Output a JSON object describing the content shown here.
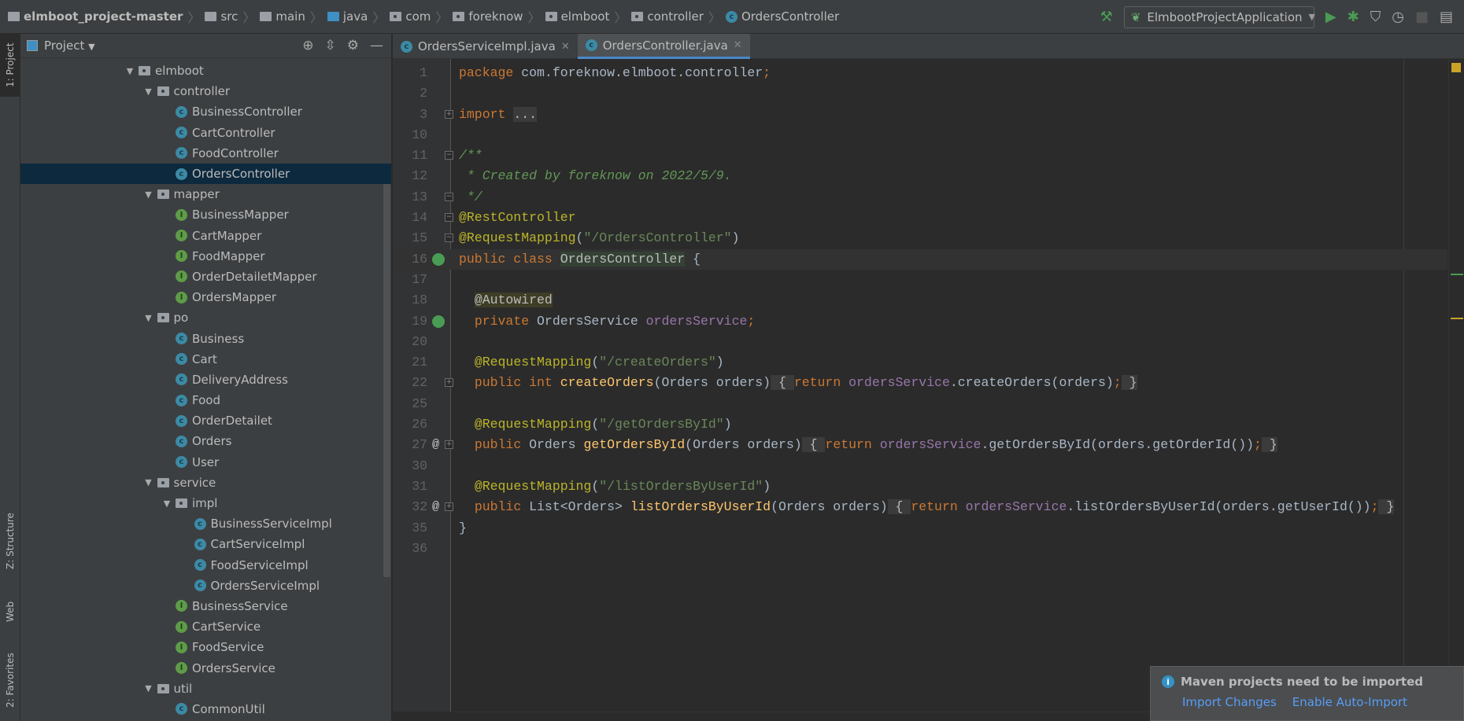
{
  "breadcrumb": [
    {
      "label": "elmboot_project-master",
      "icon": "project-folder-icon"
    },
    {
      "label": "src",
      "icon": "folder-icon"
    },
    {
      "label": "main",
      "icon": "folder-icon"
    },
    {
      "label": "java",
      "icon": "source-folder-icon"
    },
    {
      "label": "com",
      "icon": "package-icon"
    },
    {
      "label": "foreknow",
      "icon": "package-icon"
    },
    {
      "label": "elmboot",
      "icon": "package-icon"
    },
    {
      "label": "controller",
      "icon": "package-icon"
    },
    {
      "label": "OrdersController",
      "icon": "class-icon"
    }
  ],
  "toolbar": {
    "run_config": "ElmbootProjectApplication",
    "icons": [
      "build-hammer-icon",
      "run-icon",
      "debug-icon",
      "coverage-icon",
      "profile-icon",
      "stop-icon",
      "project-structure-icon"
    ]
  },
  "left_strip": {
    "project": "1: Project",
    "structure": "Z: Structure",
    "web": "Web",
    "favorites": "2: Favorites"
  },
  "panel": {
    "title": "Project"
  },
  "tree": [
    {
      "label": "elmboot",
      "level": 0,
      "type": "folder"
    },
    {
      "label": "controller",
      "level": 1,
      "type": "folder"
    },
    {
      "label": "BusinessController",
      "level": 2,
      "type": "class"
    },
    {
      "label": "CartController",
      "level": 2,
      "type": "class"
    },
    {
      "label": "FoodController",
      "level": 2,
      "type": "class"
    },
    {
      "label": "OrdersController",
      "level": 2,
      "type": "class",
      "selected": true
    },
    {
      "label": "mapper",
      "level": 1,
      "type": "folder"
    },
    {
      "label": "BusinessMapper",
      "level": 2,
      "type": "interface"
    },
    {
      "label": "CartMapper",
      "level": 2,
      "type": "interface"
    },
    {
      "label": "FoodMapper",
      "level": 2,
      "type": "interface"
    },
    {
      "label": "OrderDetailetMapper",
      "level": 2,
      "type": "interface"
    },
    {
      "label": "OrdersMapper",
      "level": 2,
      "type": "interface"
    },
    {
      "label": "po",
      "level": 1,
      "type": "folder"
    },
    {
      "label": "Business",
      "level": 2,
      "type": "class"
    },
    {
      "label": "Cart",
      "level": 2,
      "type": "class"
    },
    {
      "label": "DeliveryAddress",
      "level": 2,
      "type": "class"
    },
    {
      "label": "Food",
      "level": 2,
      "type": "class"
    },
    {
      "label": "OrderDetailet",
      "level": 2,
      "type": "class"
    },
    {
      "label": "Orders",
      "level": 2,
      "type": "class"
    },
    {
      "label": "User",
      "level": 2,
      "type": "class"
    },
    {
      "label": "service",
      "level": 1,
      "type": "folder"
    },
    {
      "label": "impl",
      "level": 2,
      "type": "folder"
    },
    {
      "label": "BusinessServiceImpl",
      "level": 3,
      "type": "class"
    },
    {
      "label": "CartServiceImpl",
      "level": 3,
      "type": "class"
    },
    {
      "label": "FoodServiceImpl",
      "level": 3,
      "type": "class"
    },
    {
      "label": "OrdersServiceImpl",
      "level": 3,
      "type": "class"
    },
    {
      "label": "BusinessService",
      "level": 2,
      "type": "interface"
    },
    {
      "label": "CartService",
      "level": 2,
      "type": "interface"
    },
    {
      "label": "FoodService",
      "level": 2,
      "type": "interface"
    },
    {
      "label": "OrdersService",
      "level": 2,
      "type": "interface"
    },
    {
      "label": "util",
      "level": 1,
      "type": "folder"
    },
    {
      "label": "CommonUtil",
      "level": 2,
      "type": "class"
    }
  ],
  "tabs": [
    {
      "label": "OrdersServiceImpl.java",
      "active": false
    },
    {
      "label": "OrdersController.java",
      "active": true
    }
  ],
  "code": [
    {
      "n": "1",
      "t": [
        [
          "package",
          "kw"
        ],
        [
          " com.foreknow.elmboot.controller",
          "pl"
        ],
        [
          ";",
          "kw"
        ]
      ]
    },
    {
      "n": "2",
      "t": []
    },
    {
      "n": "3",
      "fold": "+",
      "t": [
        [
          "import",
          "kw"
        ],
        [
          " ",
          "pl"
        ],
        [
          "...",
          "fb"
        ]
      ]
    },
    {
      "n": "10",
      "t": []
    },
    {
      "n": "11",
      "fold": "-",
      "t": [
        [
          "/**",
          "cm"
        ]
      ]
    },
    {
      "n": "12",
      "t": [
        [
          " * Created by foreknow on 2022/5/9.",
          "cm"
        ]
      ]
    },
    {
      "n": "13",
      "fold": "-",
      "t": [
        [
          " */",
          "cm"
        ]
      ]
    },
    {
      "n": "14",
      "fold": "-",
      "t": [
        [
          "@RestController",
          "an"
        ]
      ]
    },
    {
      "n": "15",
      "fold": "-",
      "t": [
        [
          "@RequestMapping",
          "an"
        ],
        [
          "(",
          "pl"
        ],
        [
          "\"/OrdersController\"",
          "st"
        ],
        [
          ")",
          "pl"
        ]
      ]
    },
    {
      "n": "16",
      "mark": "bean-class-icon",
      "cur": true,
      "t": [
        [
          "public class ",
          "kw"
        ],
        [
          "OrdersController",
          "hl"
        ],
        [
          " {",
          "pl"
        ]
      ]
    },
    {
      "n": "17",
      "t": []
    },
    {
      "n": "18",
      "t": [
        [
          "  ",
          "pl"
        ],
        [
          "@Autowired",
          "ab"
        ]
      ]
    },
    {
      "n": "19",
      "mark": "autowired-bean-icon",
      "t": [
        [
          "  ",
          "pl"
        ],
        [
          "private ",
          "kw"
        ],
        [
          "OrdersService ",
          "pl"
        ],
        [
          "ordersService",
          "fd"
        ],
        [
          ";",
          "kw"
        ]
      ]
    },
    {
      "n": "20",
      "t": []
    },
    {
      "n": "21",
      "t": [
        [
          "  ",
          "pl"
        ],
        [
          "@RequestMapping",
          "an"
        ],
        [
          "(",
          "pl"
        ],
        [
          "\"/createOrders\"",
          "st"
        ],
        [
          ")",
          "pl"
        ]
      ]
    },
    {
      "n": "22",
      "fold": "+",
      "t": [
        [
          "  ",
          "pl"
        ],
        [
          "public int ",
          "kw"
        ],
        [
          "createOrders",
          "md"
        ],
        [
          "(Orders orders)",
          "pl"
        ],
        [
          " { ",
          "fb"
        ],
        [
          "return ",
          "kw"
        ],
        [
          "ordersService",
          "fd"
        ],
        [
          ".createOrders(orders)",
          "pl"
        ],
        [
          ";",
          "kw"
        ],
        [
          " }",
          "fb"
        ]
      ]
    },
    {
      "n": "25",
      "t": []
    },
    {
      "n": "26",
      "t": [
        [
          "  ",
          "pl"
        ],
        [
          "@RequestMapping",
          "an"
        ],
        [
          "(",
          "pl"
        ],
        [
          "\"/getOrdersById\"",
          "st"
        ],
        [
          ")",
          "pl"
        ]
      ]
    },
    {
      "n": "27",
      "mark": "at-icon",
      "fold": "+",
      "t": [
        [
          "  ",
          "pl"
        ],
        [
          "public ",
          "kw"
        ],
        [
          "Orders ",
          "pl"
        ],
        [
          "getOrdersById",
          "md"
        ],
        [
          "(Orders orders)",
          "pl"
        ],
        [
          " { ",
          "fb"
        ],
        [
          "return ",
          "kw"
        ],
        [
          "ordersService",
          "fd"
        ],
        [
          ".getOrdersById(orders.getOrderId())",
          "pl"
        ],
        [
          ";",
          "kw"
        ],
        [
          " }",
          "fb"
        ]
      ]
    },
    {
      "n": "30",
      "t": []
    },
    {
      "n": "31",
      "t": [
        [
          "  ",
          "pl"
        ],
        [
          "@RequestMapping",
          "an"
        ],
        [
          "(",
          "pl"
        ],
        [
          "\"/listOrdersByUserId\"",
          "st"
        ],
        [
          ")",
          "pl"
        ]
      ]
    },
    {
      "n": "32",
      "mark": "at-icon",
      "fold": "+",
      "t": [
        [
          "  ",
          "pl"
        ],
        [
          "public ",
          "kw"
        ],
        [
          "List<Orders> ",
          "pl"
        ],
        [
          "listOrdersByUserId",
          "md"
        ],
        [
          "(Orders orders)",
          "pl"
        ],
        [
          " { ",
          "fb"
        ],
        [
          "return ",
          "kw"
        ],
        [
          "ordersService",
          "fd"
        ],
        [
          ".listOrdersByUserId(orders.getUserId())",
          "pl"
        ],
        [
          ";",
          "kw"
        ],
        [
          " }",
          "fb"
        ]
      ]
    },
    {
      "n": "35",
      "t": [
        [
          "}",
          "pl"
        ]
      ]
    },
    {
      "n": "36",
      "t": []
    }
  ],
  "notification": {
    "title": "Maven projects need to be imported",
    "actions": [
      "Import Changes",
      "Enable Auto-Import"
    ]
  },
  "colors": {
    "keyword": "#cc7832",
    "annotation": "#bbb529",
    "string": "#6a8759",
    "comment": "#629755",
    "field": "#9876aa",
    "method": "#ffc66d",
    "accent": "#4a88c7"
  }
}
